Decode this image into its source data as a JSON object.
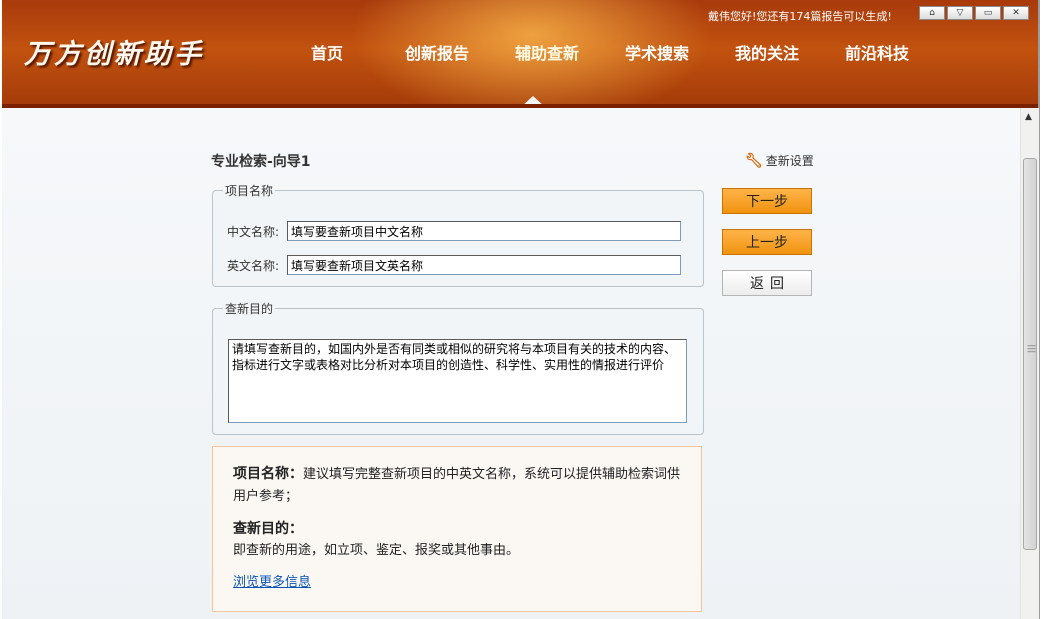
{
  "header": {
    "logo": "万方创新助手",
    "greeting": "戴伟您好!您还有174篇报告可以生成!",
    "nav": [
      {
        "label": "首页"
      },
      {
        "label": "创新报告"
      },
      {
        "label": "辅助查新"
      },
      {
        "label": "学术搜索"
      },
      {
        "label": "我的关注"
      },
      {
        "label": "前沿科技"
      }
    ],
    "active_nav": "辅助查新",
    "window_buttons": [
      "home-icon",
      "dropdown-icon",
      "minimize-icon",
      "close-icon"
    ]
  },
  "main": {
    "page_title": "专业检索-向导1",
    "settings_label": "查新设置",
    "project": {
      "legend": "项目名称",
      "cn_label": "中文名称:",
      "cn_value": "填写要查新项目中文名称",
      "en_label": "英文名称:",
      "en_value": "填写要查新项目文英名称"
    },
    "purpose": {
      "legend": "查新目的",
      "value": "请填写查新目的，如国内外是否有同类或相似的研究将与本项目有关的技术的内容、指标进行文字或表格对比分析对本项目的创造性、科学性、实用性的情报进行评价"
    },
    "buttons": {
      "next": "下一步",
      "prev": "上一步",
      "back": "返回"
    },
    "help": {
      "title1": "项目名称：",
      "text1": "建议填写完整查新项目的中英文名称，系统可以提供辅助检索词供用户参考；",
      "title2": "查新目的：",
      "text2": "即查新的用途，如立项、鉴定、报奖或其他事由。",
      "link": "浏览更多信息"
    }
  },
  "colors": {
    "header_bg": "#b5460d",
    "accent_orange": "#f0930f",
    "link": "#0a55b8"
  }
}
